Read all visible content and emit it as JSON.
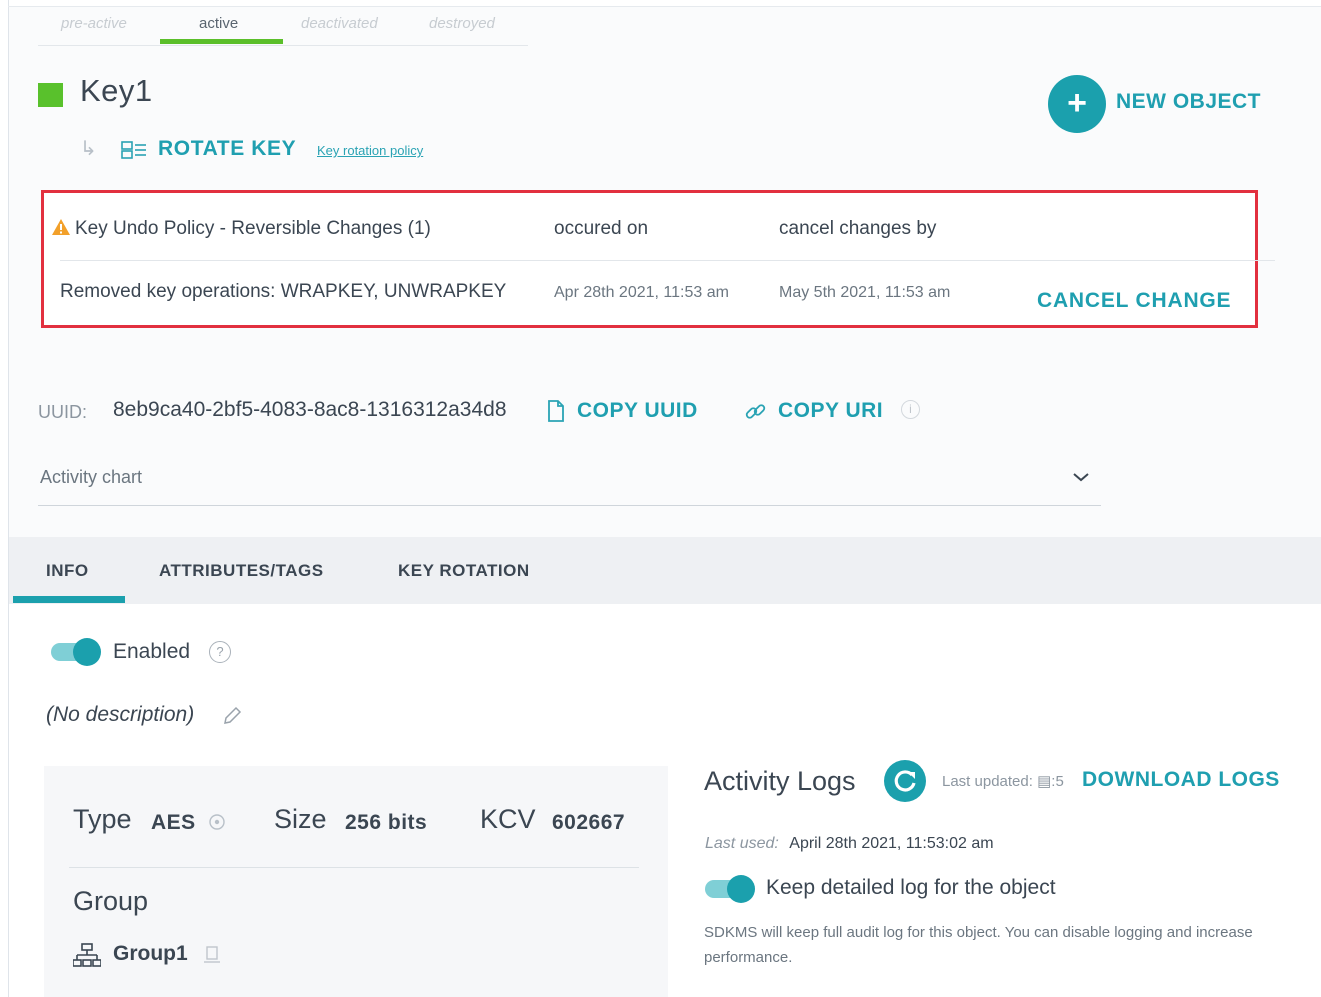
{
  "state_tabs": [
    {
      "label": "pre-active"
    },
    {
      "label": "active"
    },
    {
      "label": "deactivated"
    },
    {
      "label": "destroyed"
    }
  ],
  "key": {
    "name": "Key1",
    "status_color": "#59c12c",
    "rotate_label": "ROTATE KEY",
    "policy_link": "Key rotation policy"
  },
  "new_object": {
    "label": "NEW OBJECT",
    "icon": "plus-icon"
  },
  "undo_policy": {
    "headers": [
      "Key Undo Policy - Reversible Changes (1)",
      "occured on",
      "cancel changes by"
    ],
    "row": {
      "change": "Removed key operations: WRAPKEY, UNWRAPKEY",
      "occured_on": "Apr 28th 2021, 11:53 am",
      "cancel_by": "May 5th 2021, 11:53 am",
      "action": "CANCEL CHANGE"
    },
    "highlight_color": "#e2303f"
  },
  "uuid": {
    "label": "UUID:",
    "value": "8eb9ca40-2bf5-4083-8ac8-1316312a34d8",
    "copy_uuid": "COPY UUID",
    "copy_uri": "COPY URI",
    "info_glyph": "i"
  },
  "activity_chart": {
    "label": "Activity chart"
  },
  "tabs": [
    {
      "label": "INFO",
      "active": true
    },
    {
      "label": "ATTRIBUTES/TAGS",
      "active": false
    },
    {
      "label": "KEY ROTATION",
      "active": false
    }
  ],
  "enabled": {
    "label": "Enabled",
    "on": true,
    "help_glyph": "?"
  },
  "description": "(No description)",
  "properties": {
    "type_label": "Type",
    "type_value": "AES",
    "size_label": "Size",
    "size_value": "256 bits",
    "kcv_label": "KCV",
    "kcv_value": "602667",
    "group_label": "Group",
    "group_value": "Group1"
  },
  "activity_logs": {
    "title": "Activity Logs",
    "last_updated_label": "Last updated:",
    "last_updated_value": "5",
    "download": "DOWNLOAD LOGS",
    "last_used_label": "Last used:",
    "last_used_value": "April 28th 2021, 11:53:02 am",
    "keep_log_label": "Keep detailed log for the object",
    "keep_log_on": true,
    "note": "SDKMS will keep full audit log for this object. You can disable logging and increase performance."
  },
  "colors": {
    "accent": "#1ba0ad",
    "accent_text": "#1f9fb0",
    "active_green": "#5bbf2a"
  }
}
